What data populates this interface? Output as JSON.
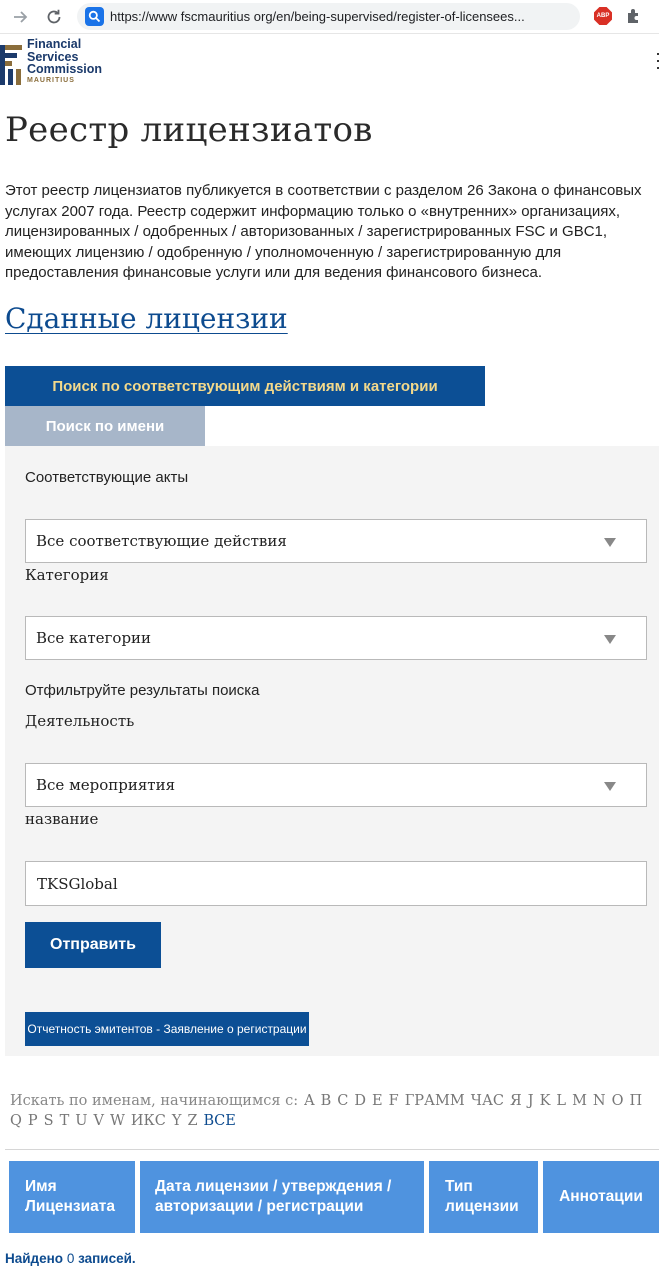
{
  "browser": {
    "url": "https://www fscmauritius org/en/being-supervised/register-of-licensees..."
  },
  "logo": {
    "line1": "Financial",
    "line2": "Services",
    "line3": "Commission",
    "line4": "MAURITIUS"
  },
  "page": {
    "title": "Реестр лицензиатов",
    "intro": "Этот реестр лицензиатов публикуется в соответствии с разделом 26 Закона о финансовых услугах 2007 года. Реестр содержит информацию только о «внутренних» организациях, лицензированных / одобренных / авторизованных / зарегистрированных FSC и GBC1, имеющих лицензию / одобренную / уполномоченную / зарегистрированную для предоставления финансовые услуги или для ведения финансового бизнеса.",
    "section_link": "Сданные лицензии"
  },
  "tabs": {
    "active": "Поиск по соответствующим действиям и категории",
    "inactive": "Поиск по имени"
  },
  "form": {
    "acts_label": "Соответствующие акты",
    "acts_value": "Все соответствующие действия",
    "category_label": "Категория",
    "category_value": "Все категории",
    "filter_label": "Отфильтруйте результаты поиска",
    "activity_label": "Деятельность",
    "activity_value": "Все мероприятия",
    "name_label": "название",
    "name_value": "TKSGlobal",
    "submit": "Отправить",
    "report_button": "Отчетность эмитентов - Заявление о регистрации"
  },
  "alphabet": {
    "prefix": "Искать по именам, начинающимся с:",
    "row1": [
      "A",
      "B",
      "C",
      "D",
      "E",
      "F",
      "ГРАММ",
      "ЧАС",
      "Я",
      "J",
      "K",
      "L",
      "M",
      "N",
      "O",
      "П"
    ],
    "row2": [
      "Q",
      "P",
      "S",
      "T",
      "U",
      "V",
      "W",
      "ИКС",
      "Y",
      "Z"
    ],
    "all": "ВСЕ"
  },
  "table": {
    "headers": [
      "Имя Лицензиата",
      "Дата лицензии / утверждения / авторизации / регистрации",
      "Тип лицензии",
      "Аннотации"
    ]
  },
  "results": {
    "prefix": "Найдено",
    "count": "0",
    "suffix": "записей."
  }
}
